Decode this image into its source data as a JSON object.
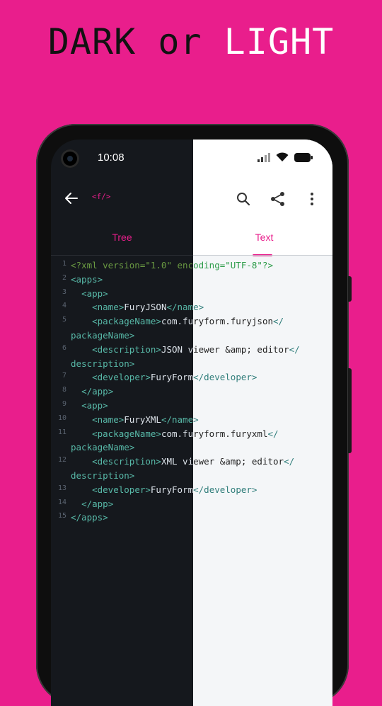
{
  "headline": {
    "dark": "DARK",
    "or": "or",
    "light": "LIGHT"
  },
  "status": {
    "time": "10:08"
  },
  "toolbar": {
    "logo": "<f/>"
  },
  "tabs": [
    {
      "label": "Tree"
    },
    {
      "label": "Text"
    }
  ],
  "colors": {
    "accent": "#e91e8c",
    "dark_bg": "#15181d",
    "light_bg": "#f4f6f8"
  },
  "code_lines": [
    {
      "num": "1",
      "text": "<?xml version=\"1.0\" encoding=\"UTF-8\"?>"
    },
    {
      "num": "2",
      "text": "<apps>"
    },
    {
      "num": "3",
      "text": "  <app>"
    },
    {
      "num": "4",
      "text": "    <name>FuryJSON</name>"
    },
    {
      "num": "5",
      "text": "    <packageName>com.furyform.furyjson</"
    },
    {
      "num": "",
      "text": "packageName>"
    },
    {
      "num": "6",
      "text": "    <description>JSON viewer &amp; editor</"
    },
    {
      "num": "",
      "text": "description>"
    },
    {
      "num": "7",
      "text": "    <developer>FuryForm</developer>"
    },
    {
      "num": "8",
      "text": "  </app>"
    },
    {
      "num": "9",
      "text": "  <app>"
    },
    {
      "num": "10",
      "text": "    <name>FuryXML</name>"
    },
    {
      "num": "11",
      "text": "    <packageName>com.furyform.furyxml</"
    },
    {
      "num": "",
      "text": "packageName>"
    },
    {
      "num": "12",
      "text": "    <description>XML viewer &amp; editor</"
    },
    {
      "num": "",
      "text": "description>"
    },
    {
      "num": "13",
      "text": "    <developer>FuryForm</developer>"
    },
    {
      "num": "14",
      "text": "  </app>"
    },
    {
      "num": "15",
      "text": "</apps>"
    }
  ]
}
